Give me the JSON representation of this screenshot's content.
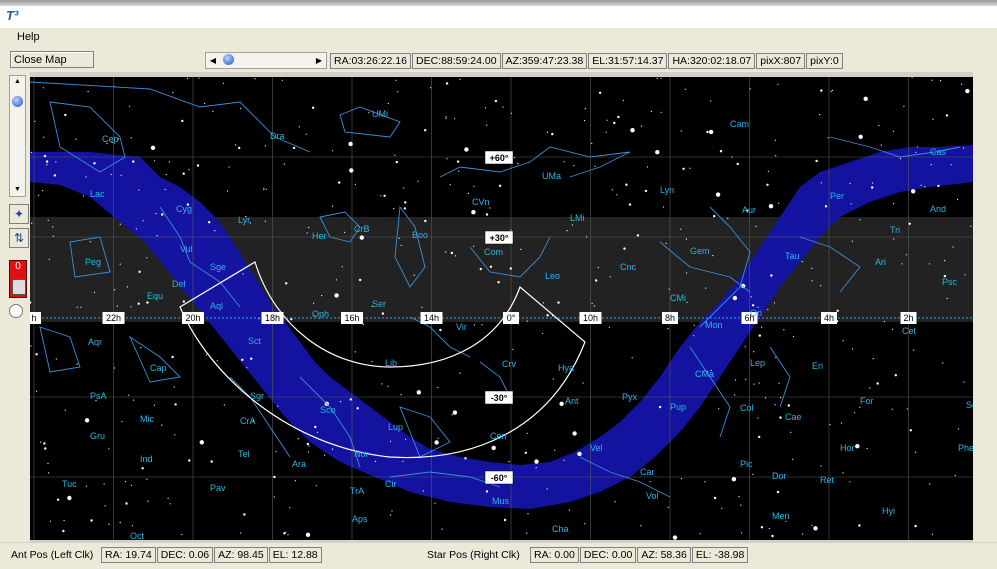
{
  "menu": {
    "help": "Help"
  },
  "toolbar": {
    "close_label": "Close Map",
    "readouts": [
      "RA:03:26:22.16",
      "DEC:88:59:24.00",
      "AZ:359:47:23.38",
      "EL:31:57:14.37",
      "HA:320:02:18.07",
      "pixX:807",
      "pixY:0"
    ]
  },
  "left_panel": {
    "indicator": "0"
  },
  "map": {
    "ra_ticks": [
      "h",
      "22h",
      "20h",
      "18h",
      "16h",
      "14h",
      "0°",
      "10h",
      "8h",
      "6h",
      "4h",
      "2h",
      "0"
    ],
    "dec_labels": [
      "+60°",
      "+30°",
      "-30°",
      "-60°"
    ],
    "constellations": [
      {
        "name": "UMi"
      },
      {
        "name": "Cep"
      },
      {
        "name": "Dra"
      },
      {
        "name": "Cam"
      },
      {
        "name": "Cas"
      },
      {
        "name": "+60"
      },
      {
        "name": "UMa"
      },
      {
        "name": "Lac"
      },
      {
        "name": "Cyg"
      },
      {
        "name": "CVn"
      },
      {
        "name": "Lyn"
      },
      {
        "name": "Aur"
      },
      {
        "name": "Per"
      },
      {
        "name": "And"
      },
      {
        "name": "Lyr"
      },
      {
        "name": "Her"
      },
      {
        "name": "CrB"
      },
      {
        "name": "Boo"
      },
      {
        "name": "LMi"
      },
      {
        "name": "Tri"
      },
      {
        "name": "Com"
      },
      {
        "name": "Gem"
      },
      {
        "name": "Vul"
      },
      {
        "name": "Peg"
      },
      {
        "name": "Sge"
      },
      {
        "name": "Leo"
      },
      {
        "name": "Cnc"
      },
      {
        "name": "Tau"
      },
      {
        "name": "Ari"
      },
      {
        "name": "Del"
      },
      {
        "name": "Equ"
      },
      {
        "name": "Aql"
      },
      {
        "name": "Ser"
      },
      {
        "name": "CMi"
      },
      {
        "name": "Psc"
      },
      {
        "name": "Oph"
      },
      {
        "name": "Vir"
      },
      {
        "name": "Ori"
      },
      {
        "name": "Mon"
      },
      {
        "name": "Cet"
      },
      {
        "name": "Aqr"
      },
      {
        "name": "Sct"
      },
      {
        "name": "Cap"
      },
      {
        "name": "Lib"
      },
      {
        "name": "Crv"
      },
      {
        "name": "Hya"
      },
      {
        "name": "Lep"
      },
      {
        "name": "Eri"
      },
      {
        "name": "CMa"
      },
      {
        "name": "PsA"
      },
      {
        "name": "Sgr"
      },
      {
        "name": "Sco"
      },
      {
        "name": "Ant"
      },
      {
        "name": "Pyx"
      },
      {
        "name": "Col"
      },
      {
        "name": "For"
      },
      {
        "name": "Scl"
      },
      {
        "name": "Mic"
      },
      {
        "name": "CrA"
      },
      {
        "name": "Lup"
      },
      {
        "name": "Cen"
      },
      {
        "name": "Pup"
      },
      {
        "name": "Cae"
      },
      {
        "name": "Gru"
      },
      {
        "name": "Ind"
      },
      {
        "name": "Tel"
      },
      {
        "name": "Nor"
      },
      {
        "name": "Vel"
      },
      {
        "name": "Hor"
      },
      {
        "name": "Phe"
      },
      {
        "name": "Ara"
      },
      {
        "name": "Pic"
      },
      {
        "name": "Tuc"
      },
      {
        "name": "Pav"
      },
      {
        "name": "TrA"
      },
      {
        "name": "Cir"
      },
      {
        "name": "Car"
      },
      {
        "name": "Dor"
      },
      {
        "name": "Ret"
      },
      {
        "name": "Mus"
      },
      {
        "name": "Vol"
      },
      {
        "name": "Aps"
      },
      {
        "name": "Men"
      },
      {
        "name": "Hyi"
      },
      {
        "name": "Oct"
      },
      {
        "name": "Cha"
      }
    ],
    "colors": {
      "milky_way": "#1a1ab0",
      "lines": "#3aa0e0",
      "labels": "#29b6e8",
      "band": "#202020"
    }
  },
  "status": {
    "ant_label": "Ant Pos (Left Clk)",
    "ant": [
      "RA:   19.74",
      "DEC:   0.06",
      "AZ:   98.45",
      "EL:   12.88"
    ],
    "star_label": "Star Pos (Right Clk)",
    "star": [
      "RA:    0.00",
      "DEC:   0.00",
      "AZ:   58.36",
      "EL:   -38.98"
    ]
  }
}
